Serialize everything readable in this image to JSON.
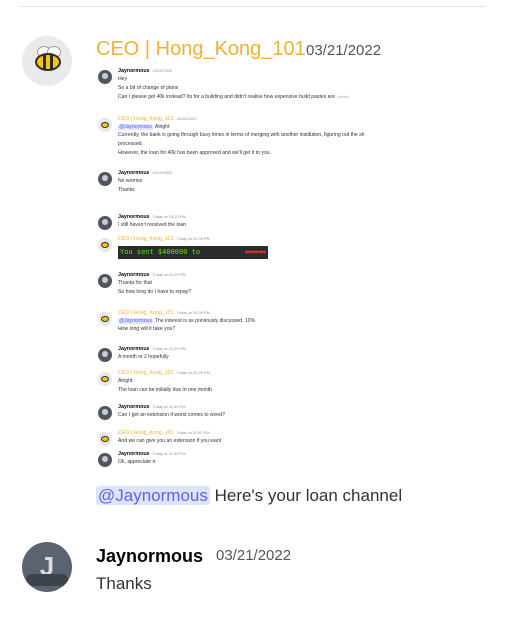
{
  "messages": [
    {
      "author": "CEO | Hong_Kong_101",
      "date": "03/21/2022",
      "embedded": [
        {
          "author": "Jaynormous",
          "time": "03/16/2022",
          "lines": [
            "Hey",
            "So a bit of change of plans",
            "Can I please get 40k instead? Its for a building and didn't realise how expensive build pastes are"
          ],
          "edited": "(edited)"
        },
        {
          "author": "CEO | Hong_Kong_101",
          "time": "03/16/2022",
          "mention": "@Jaynormous",
          "mention_text": "Alright",
          "lines": [
            "Currently, the bank is going through busy times in terms of merging with another institution, figuring out the sh",
            "processed.",
            "However, the loan for 40k has been approved and we'll get it to you."
          ]
        },
        {
          "author": "Jaynormous",
          "time": "03/16/2022",
          "lines": [
            "No worries",
            "Thanks"
          ]
        },
        {
          "author": "Jaynormous",
          "time": "Today at 10:29 PM",
          "lines": [
            "I still haven't received the loan"
          ]
        },
        {
          "author": "CEO | Hong_Kong_101",
          "time": "Today at 10:39 PM",
          "sent_text": "You sent $400000 to"
        },
        {
          "author": "Jaynormous",
          "time": "Today at 10:39 PM",
          "lines": [
            "Thanks for that",
            "So how long do I have to repay?"
          ]
        },
        {
          "author": "CEO | Hong_Kong_101",
          "time": "Today at 10:39 PM",
          "mention": "@Jaynormous",
          "mention_text": "The interest is as previously discussed, 10%",
          "lines": [
            "How long will it take you?"
          ]
        },
        {
          "author": "Jaynormous",
          "time": "Today at 10:39 PM",
          "lines": [
            "A month or 2 hopefully"
          ]
        },
        {
          "author": "CEO | Hong_Kong_101",
          "time": "Today at 10:39 PM",
          "lines": [
            "Alright",
            "The loan can be initially due in one month"
          ]
        },
        {
          "author": "Jaynormous",
          "time": "Today at 11:00 PM",
          "lines": [
            "Can I get an extension if worst comes to worst?"
          ]
        },
        {
          "author": "CEO | Hong_Kong_101",
          "time": "Today at 11:00 PM",
          "lines": [
            "And we can give you an extension if you want"
          ]
        },
        {
          "author": "Jaynormous",
          "time": "Today at 11:00 PM",
          "lines": [
            "Ok, appreciate it"
          ]
        }
      ],
      "mention": "@Jaynormous",
      "text": " Here's your loan channel"
    },
    {
      "author": "Jaynormous",
      "date": "03/21/2022",
      "text": "Thanks"
    }
  ],
  "colors": {
    "gold_author": "#f0b132",
    "mention_bg": "#e0e4fb",
    "mention_fg": "#5865f2"
  }
}
